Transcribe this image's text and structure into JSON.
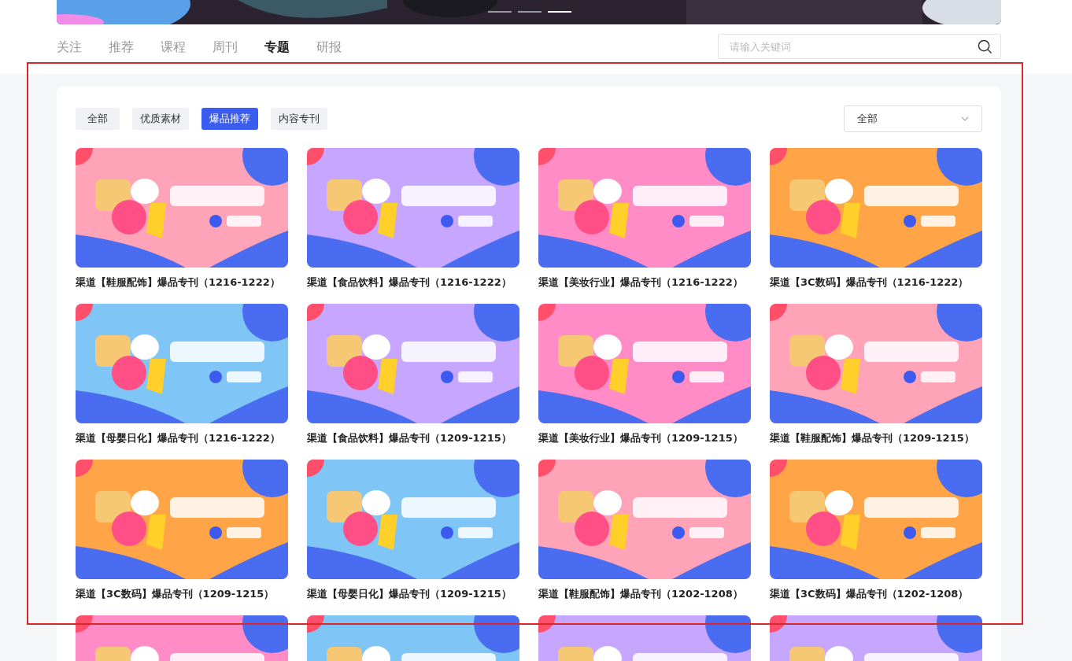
{
  "banner": {
    "kind": "picture",
    "dots": [
      {
        "selected": false
      },
      {
        "selected": false
      },
      {
        "selected": true
      }
    ]
  },
  "nav_tabs": [
    {
      "label": "关注",
      "selected": false
    },
    {
      "label": "推荐",
      "selected": false
    },
    {
      "label": "课程",
      "selected": false
    },
    {
      "label": "周刊",
      "selected": false
    },
    {
      "label": "专题",
      "selected": true
    },
    {
      "label": "研报",
      "selected": false
    }
  ],
  "search": {
    "placeholder": "请输入关键词"
  },
  "filters": [
    {
      "label": "全部",
      "selected": false
    },
    {
      "label": "优质素材",
      "selected": false
    },
    {
      "label": "爆品推荐",
      "selected": true
    },
    {
      "label": "内容专刊",
      "selected": false
    }
  ],
  "dropdown": {
    "value": "全部"
  },
  "cards": [
    {
      "title": "渠道【鞋服配饰】爆品专刊（1216-1222）",
      "color": "#ffa3b8"
    },
    {
      "title": "渠道【食品饮料】爆品专刊（1216-1222）",
      "color": "#c7a6ff"
    },
    {
      "title": "渠道【美妆行业】爆品专刊（1216-1222）",
      "color": "#ff8cc6"
    },
    {
      "title": "渠道【3C数码】爆品专刊（1216-1222）",
      "color": "#ffa548"
    },
    {
      "title": "渠道【母婴日化】爆品专刊（1216-1222）",
      "color": "#7fc6f6"
    },
    {
      "title": "渠道【食品饮料】爆品专刊（1209-1215）",
      "color": "#c7a6ff"
    },
    {
      "title": "渠道【美妆行业】爆品专刊（1209-1215）",
      "color": "#ff8cc6"
    },
    {
      "title": "渠道【鞋服配饰】爆品专刊（1209-1215）",
      "color": "#ffa3b8"
    },
    {
      "title": "渠道【3C数码】爆品专刊（1209-1215）",
      "color": "#ffa548"
    },
    {
      "title": "渠道【母婴日化】爆品专刊（1209-1215）",
      "color": "#7fc6f6"
    },
    {
      "title": "渠道【鞋服配饰】爆品专刊（1202-1208）",
      "color": "#ffa3b8"
    },
    {
      "title": "渠道【3C数码】爆品专刊（1202-1208）",
      "color": "#ffa548"
    },
    {
      "color": "#ff8cc6"
    },
    {
      "color": "#7fc6f6"
    },
    {
      "color": "#c7a6ff"
    },
    {
      "color": "#c7a6ff"
    }
  ],
  "highlight": {
    "shown": true
  }
}
